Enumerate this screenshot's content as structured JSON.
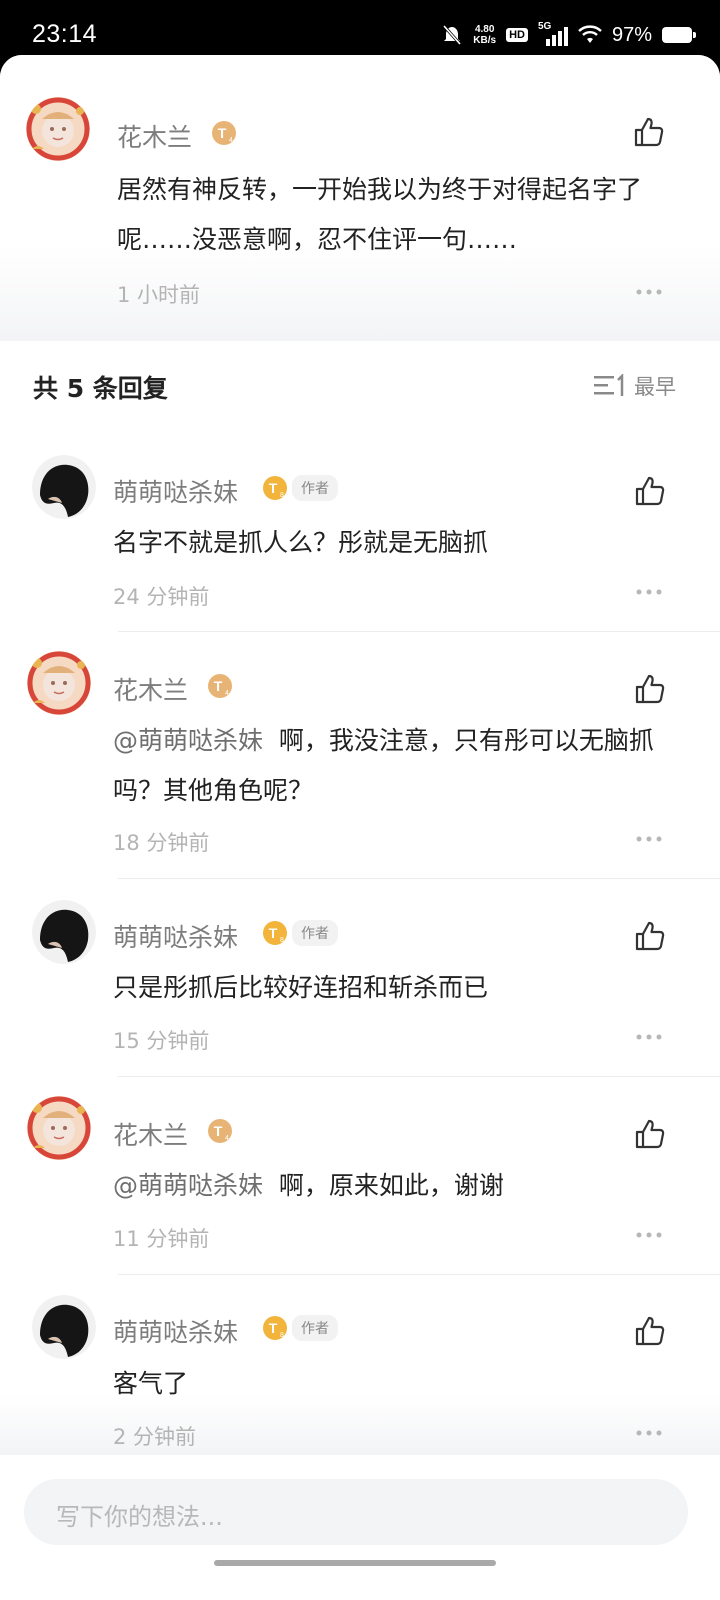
{
  "status_bar": {
    "time": "23:14",
    "net_speed_value": "4.80",
    "net_speed_unit": "KB/s",
    "hd_label": "HD",
    "network_label": "5G",
    "battery_percent": "97%"
  },
  "main_comment": {
    "username": "花木兰",
    "content": "居然有神反转，一开始我以为终于对得起名字了呢……没恶意啊，忍不住评一句……",
    "time": "1 小时前"
  },
  "replies_header": {
    "title": "共 5 条回复",
    "sort_label": "最早"
  },
  "replies": [
    {
      "username": "萌萌哒杀妹",
      "badge": "作者",
      "mention": "",
      "content": "名字不就是抓人么？彤就是无脑抓",
      "time": "24 分钟前"
    },
    {
      "username": "花木兰",
      "badge": "",
      "mention": "@萌萌哒杀妹",
      "content": "啊，我没注意，只有彤可以无脑抓吗？其他角色呢？",
      "time": "18 分钟前"
    },
    {
      "username": "萌萌哒杀妹",
      "badge": "作者",
      "mention": "",
      "content": "只是彤抓后比较好连招和斩杀而已",
      "time": "15 分钟前"
    },
    {
      "username": "花木兰",
      "badge": "",
      "mention": "@萌萌哒杀妹",
      "content": "啊，原来如此，谢谢",
      "time": "11 分钟前"
    },
    {
      "username": "萌萌哒杀妹",
      "badge": "作者",
      "mention": "",
      "content": "客气了",
      "time": "2 分钟前"
    }
  ],
  "input": {
    "placeholder": "写下你的想法..."
  },
  "colors": {
    "level_badge_main": "#e8b476",
    "level_badge_author": "#f2b43a",
    "text_primary": "#222222",
    "text_secondary": "#7d7d7d"
  }
}
